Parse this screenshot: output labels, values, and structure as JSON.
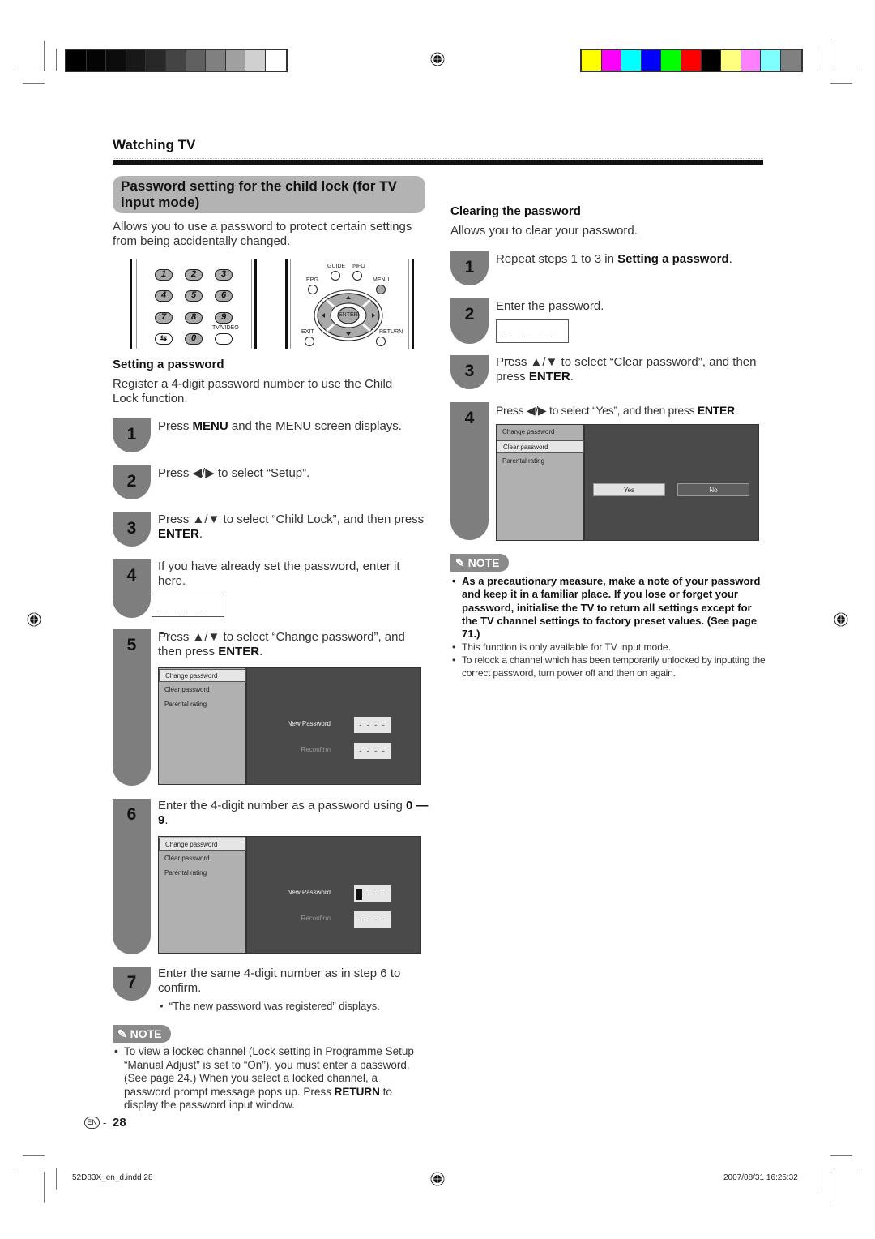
{
  "print_marks": {
    "gray_swatches": [
      "#000000",
      "#040404",
      "#0c0c0c",
      "#181818",
      "#282828",
      "#444444",
      "#606060",
      "#808080",
      "#a0a0a0",
      "#d0d0d0",
      "#ffffff"
    ],
    "color_swatches": [
      "#ffff00",
      "#ff00ff",
      "#00ffff",
      "#0000ff",
      "#00ff00",
      "#ff0000",
      "#000000",
      "#ffff80",
      "#ff80ff",
      "#80ffff",
      "#808080"
    ]
  },
  "header": {
    "section_title": "Watching TV"
  },
  "left": {
    "title_pill": "Password setting for the child lock (for TV input mode)",
    "intro": "Allows you to use a password to protect certain settings from being accidentally changed.",
    "remote": {
      "keys": [
        "1",
        "2",
        "3",
        "4",
        "5",
        "6",
        "7",
        "8",
        "9",
        "0"
      ],
      "tv_video_label": "TV/VIDEO",
      "guide": "GUIDE",
      "info": "INFO",
      "epg": "EPG",
      "menu": "MENU",
      "enter": "ENTER",
      "exit": "EXIT",
      "return": "RETURN"
    },
    "setting_heading": "Setting a password",
    "setting_intro": "Register a 4-digit password number to use the Child Lock function.",
    "steps": [
      {
        "num": "1",
        "pre": "Press ",
        "bold": "MENU",
        "post": " and the MENU screen displays."
      },
      {
        "num": "2",
        "pre": "Press ◀/▶ to select “Setup”.",
        "bold": "",
        "post": ""
      },
      {
        "num": "3",
        "pre": "Press ▲/▼ to select “Child Lock”, and then press ",
        "bold": "ENTER",
        "post": "."
      },
      {
        "num": "4",
        "pre": "If you have already set the password, enter it here.",
        "bold": "",
        "post": ""
      },
      {
        "num": "5",
        "pre": "Press ▲/▼ to select “Change password”, and then press ",
        "bold": "ENTER",
        "post": "."
      },
      {
        "num": "6",
        "pre": "Enter the 4-digit number as a password using ",
        "bold": "0 — 9",
        "post": "."
      },
      {
        "num": "7",
        "pre": "Enter the same 4-digit number as in step 6 to confirm.",
        "bold": "",
        "post": ""
      }
    ],
    "pw_placeholder": "_ _ _ _",
    "step7_bullet": "“The new password was registered” displays.",
    "note_label": "NOTE",
    "note_pre": "To view a locked channel (Lock setting in Programme Setup “Manual Adjust” is set to “On”), you must enter a password. (See page 24.) When you select a locked channel, a password prompt message pops up. Press ",
    "note_bold": "RETURN",
    "note_post": " to display the password input window."
  },
  "tv_menu": {
    "items": [
      "Change password",
      "Clear password",
      "Parental rating"
    ],
    "new_password_label": "New Password",
    "reconfirm_label": "Reconfirm",
    "field_value": "- - - -",
    "field_value_active": "- - -",
    "yes": "Yes",
    "no": "No"
  },
  "right": {
    "heading": "Clearing the password",
    "intro": "Allows you to clear your password.",
    "steps": [
      {
        "num": "1",
        "pre": "Repeat steps 1 to 3 in ",
        "bold": "Setting a password",
        "post": "."
      },
      {
        "num": "2",
        "pre": "Enter the password.",
        "bold": "",
        "post": ""
      },
      {
        "num": "3",
        "pre": "Press ▲/▼ to select “Clear password”, and then press ",
        "bold": "ENTER",
        "post": "."
      },
      {
        "num": "4",
        "pre": "Press ◀/▶ to select “Yes”, and then press ",
        "bold": "ENTER",
        "post": "."
      }
    ],
    "note_label": "NOTE",
    "notes": [
      "As a precautionary measure, make a note of your password and keep it in a familiar place. If you lose or forget your password, initialise the TV to return all settings except for the TV channel settings to factory preset values. (See page 71.)",
      "This function is only available for TV input mode.",
      "To relock a channel which has been temporarily unlocked by inputting the correct password, turn power off and then on again."
    ]
  },
  "footer": {
    "lang_badge": "EN",
    "page_number": "28",
    "file_name": "52D83X_en_d.indd  28",
    "timestamp": "2007/08/31   16:25:32"
  }
}
